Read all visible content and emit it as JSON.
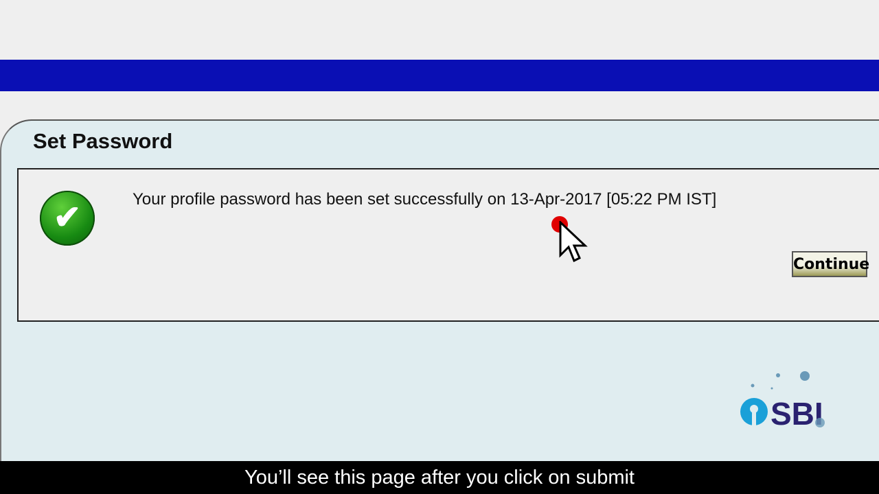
{
  "dialog": {
    "title": "Set Password",
    "message": "Your profile password has been set successfully on 13-Apr-2017 [05:22 PM IST]",
    "continue_label": "Continue"
  },
  "logo": {
    "text": "SBI"
  },
  "caption": "You’ll see this page after you click on submit",
  "colors": {
    "header_bar": "#0a0fb4",
    "logo_blue": "#1aa0d8",
    "logo_navy": "#2a2270"
  }
}
